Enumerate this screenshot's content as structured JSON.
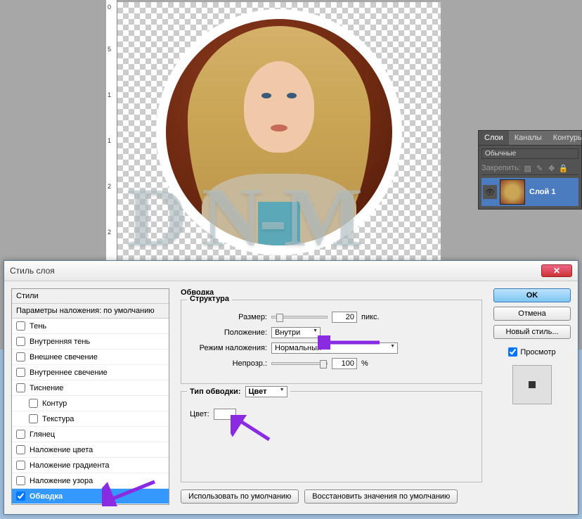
{
  "ruler_ticks": [
    "0",
    "5",
    "1",
    "1",
    "2",
    "2"
  ],
  "watermark": "D N-M",
  "panels": {
    "tabs": [
      "Слои",
      "Каналы",
      "Контуры"
    ],
    "blend_mode": "Обычные",
    "lock_label": "Закрепить:",
    "layer_name": "Слой 1"
  },
  "dialog": {
    "title": "Стиль слоя",
    "styles_header": "Стили",
    "blend_header": "Параметры наложения: по умолчанию",
    "styles": [
      {
        "label": "Тень",
        "checked": false
      },
      {
        "label": "Внутренняя тень",
        "checked": false
      },
      {
        "label": "Внешнее свечение",
        "checked": false
      },
      {
        "label": "Внутреннее свечение",
        "checked": false
      },
      {
        "label": "Тиснение",
        "checked": false
      },
      {
        "label": "Контур",
        "checked": false,
        "sub": true
      },
      {
        "label": "Текстура",
        "checked": false,
        "sub": true
      },
      {
        "label": "Глянец",
        "checked": false
      },
      {
        "label": "Наложение цвета",
        "checked": false
      },
      {
        "label": "Наложение градиента",
        "checked": false
      },
      {
        "label": "Наложение узора",
        "checked": false
      },
      {
        "label": "Обводка",
        "checked": true,
        "active": true
      }
    ],
    "section_title": "Обводка",
    "structure_title": "Структура",
    "size_label": "Размер:",
    "size_value": "20",
    "size_unit": "пикс.",
    "position_label": "Положение:",
    "position_value": "Внутри",
    "blend_label": "Режим наложения:",
    "blend_value": "Нормальный",
    "opacity_label": "Непрозр.:",
    "opacity_value": "100",
    "opacity_unit": "%",
    "stroke_type_label": "Тип обводки:",
    "stroke_type_value": "Цвет",
    "color_label": "Цвет:",
    "default_btn": "Использовать по умолчанию",
    "reset_btn": "Восстановить значения по умолчанию",
    "ok": "OK",
    "cancel": "Отмена",
    "new_style": "Новый стиль...",
    "preview": "Просмотр"
  }
}
